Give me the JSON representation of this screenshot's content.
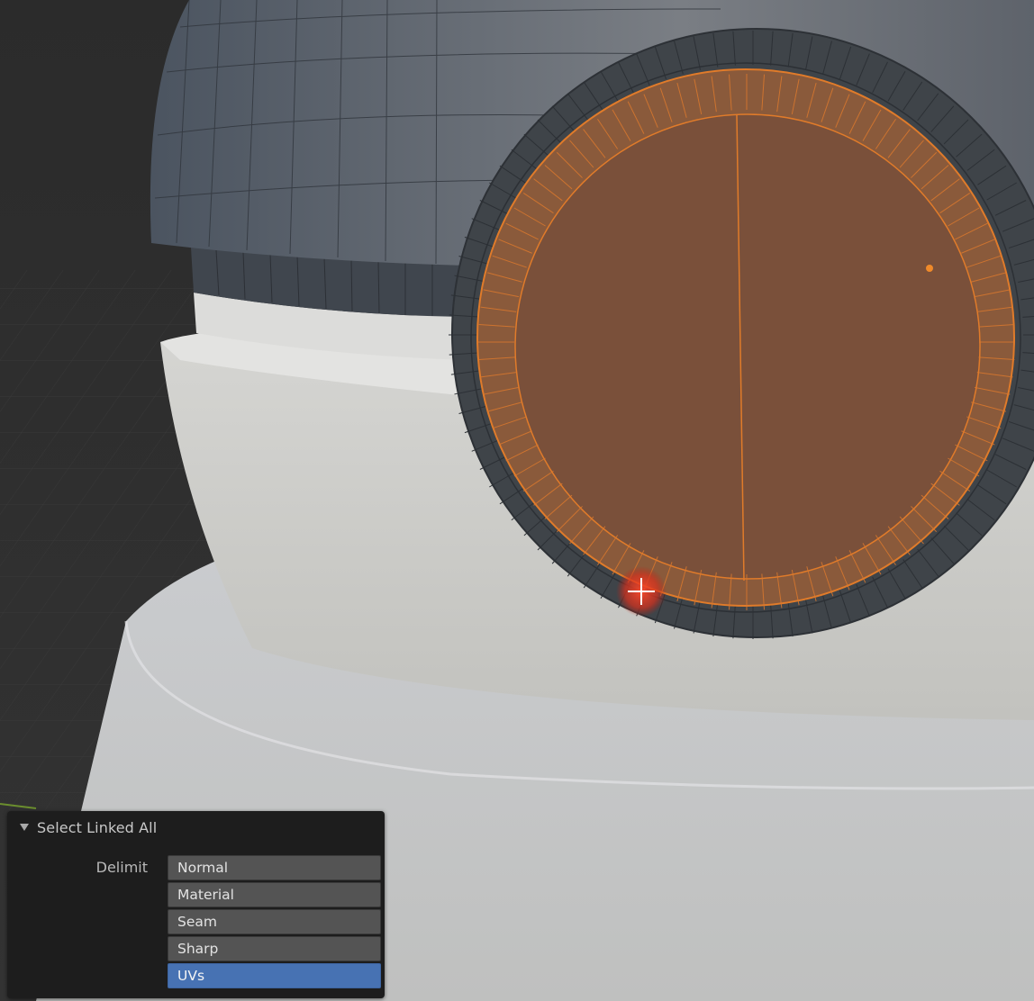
{
  "operator_panel": {
    "title": "Select Linked All",
    "delimit_label": "Delimit",
    "options": [
      {
        "label": "Normal",
        "active": false
      },
      {
        "label": "Material",
        "active": false
      },
      {
        "label": "Seam",
        "active": false
      },
      {
        "label": "Sharp",
        "active": false
      },
      {
        "label": "UVs",
        "active": true
      }
    ]
  },
  "colors": {
    "selection": "#e07b2a",
    "active_option": "#4772b3",
    "panel_bg": "#1d1d1d",
    "option_bg": "#545454"
  }
}
